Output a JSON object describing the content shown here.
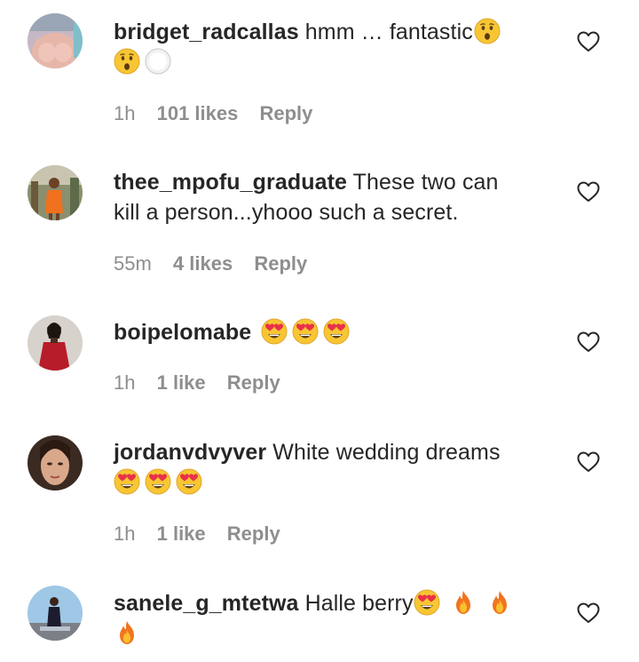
{
  "comments": [
    {
      "username": "bridget_radcallas",
      "text": "hmm … fantastic",
      "time": "1h",
      "likes": "101 likes",
      "reply": "Reply"
    },
    {
      "username": "thee_mpofu_graduate",
      "text_line1": "These two can",
      "text_line2": "kill a person...yhooo such a secret.",
      "time": "55m",
      "likes": "4 likes",
      "reply": "Reply"
    },
    {
      "username": "boipelomabe",
      "text": "",
      "time": "1h",
      "likes": "1 like",
      "reply": "Reply"
    },
    {
      "username": "jordanvdvyver",
      "text": "White wedding dreams",
      "time": "1h",
      "likes": "1 like",
      "reply": "Reply"
    },
    {
      "username": "sanele_g_mtetwa",
      "text": "Halle berry",
      "time": "",
      "likes": "",
      "reply": ""
    }
  ],
  "icons": {
    "like": "heart-outline-icon",
    "emoji_hushed": "hushed-face-emoji",
    "emoji_heart_eyes": "heart-eyes-emoji",
    "emoji_fire": "fire-emoji",
    "emoji_circle": "white-circle-emoji"
  },
  "colors": {
    "text": "#262626",
    "meta": "#8e8e8e",
    "background": "#ffffff"
  }
}
